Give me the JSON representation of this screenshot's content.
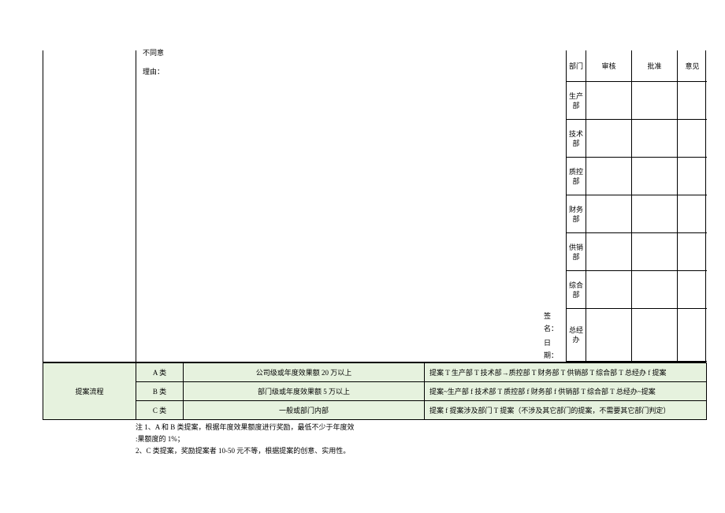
{
  "upper": {
    "disagree": "不同意",
    "reason_label": "理由：",
    "sign_label": "签名：",
    "date_label": "日期："
  },
  "right_headers": {
    "dept": "部门",
    "review": "审核",
    "approve": "批准",
    "opinion": "意见"
  },
  "right_rows": [
    "生产部",
    "技术部",
    "质控部",
    "财务部",
    "供销部",
    "综合部",
    "总经办"
  ],
  "flow": {
    "row_label": "提案流程",
    "rows": [
      {
        "cat": "A 类",
        "desc": "公司级或年度效果额 20 万以上",
        "path": "提案 T 生产部 T 技术部→质控部 T 财务部 T 供销部 T 综合部 T 总经办 f 提案"
      },
      {
        "cat": "B 类",
        "desc": "部门级或年度效果额 5 万以上",
        "path": "提案~生产部 f 技术部 T 质控部 f 财务部 f 供销部 T 综合部 T 总经办~提案"
      },
      {
        "cat": "C 类",
        "desc": "一般或部门内部",
        "path": "提案 f 提案涉及部门 T 提案（不涉及其它部门的提案，不需要其它部门判定）"
      }
    ]
  },
  "notes": {
    "n1a": "注 1、A 和 B 类提案，根据年度效果额度进行奖励，最低不少于年度效",
    "n1b": ":果额度的 1%；",
    "n2": "2、C 类提案，奖励提案者 10-50 元不等，根据提案的创意、实用性。"
  }
}
